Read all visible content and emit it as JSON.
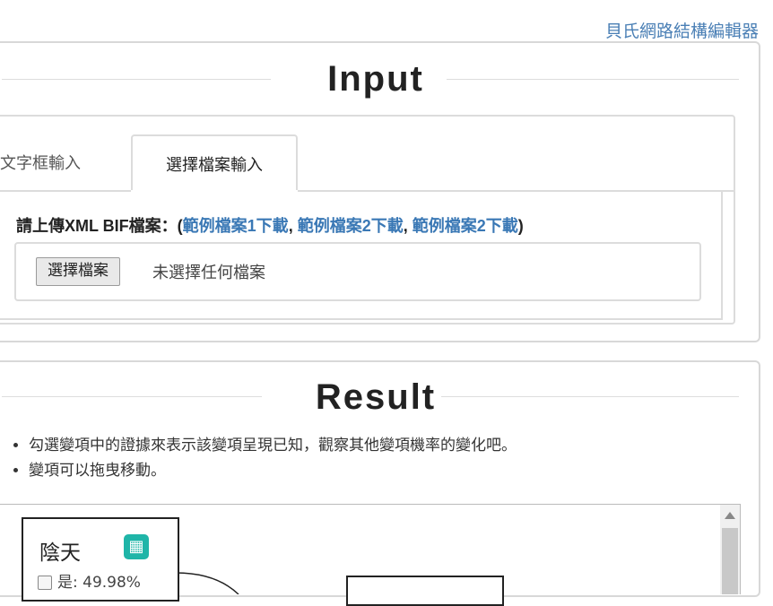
{
  "header": {
    "top_link": "貝氏網路結構編輯器"
  },
  "input_section": {
    "title": "Input",
    "tabs": [
      {
        "label": "文字框輸入",
        "active": false
      },
      {
        "label": "選擇檔案輸入",
        "active": true
      }
    ],
    "upload_label": "請上傳XML BIF檔案：(",
    "links": [
      "範例檔案1下載",
      "範例檔案2下載",
      "範例檔案2下載"
    ],
    "label_close": ")",
    "file_button": "選擇檔案",
    "file_status": "未選擇任何檔案"
  },
  "result_section": {
    "title": "Result",
    "instructions": [
      "勾選變項中的證據來表示該變項呈現已知，觀察其他變項機率的變化吧。",
      "變項可以拖曳移動。"
    ],
    "nodes": [
      {
        "title": "陰天",
        "state_label": "是: 49.98%"
      }
    ]
  },
  "colors": {
    "link": "#3a78b5",
    "grid_icon": "#1fb5a8"
  },
  "icons": {
    "node_table": "table-grid-icon"
  }
}
